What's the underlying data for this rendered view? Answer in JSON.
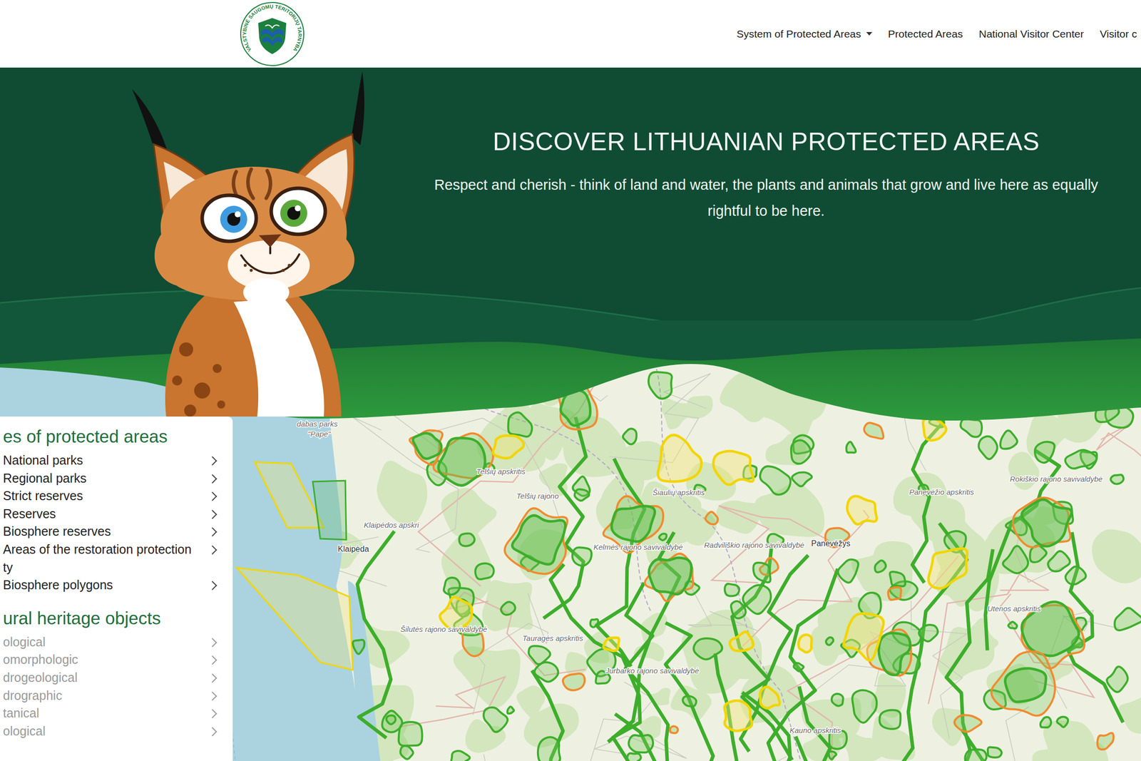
{
  "header": {
    "logo_text": "VALSTYBINĖ SAUGOMŲ TERITORIJŲ TARNYBA",
    "nav": [
      {
        "label": "System of Protected Areas",
        "dropdown": true
      },
      {
        "label": "Protected Areas",
        "dropdown": false
      },
      {
        "label": "National Visitor Center",
        "dropdown": false
      },
      {
        "label": "Visitor c",
        "dropdown": false
      }
    ]
  },
  "hero": {
    "title": "DISCOVER LITHUANIAN PROTECTED AREAS",
    "subtitle": "Respect and cherish - think of land and water, the plants and animals that grow and live here as equally rightful to be here."
  },
  "sidebar": {
    "sections": [
      {
        "title": "es of protected areas",
        "items": [
          {
            "lines": [
              "National parks"
            ],
            "muted": false
          },
          {
            "lines": [
              "Regional parks"
            ],
            "muted": false
          },
          {
            "lines": [
              "Strict reserves"
            ],
            "muted": false
          },
          {
            "lines": [
              "Reserves"
            ],
            "muted": false
          },
          {
            "lines": [
              "Biosphere reserves"
            ],
            "muted": false
          },
          {
            "lines": [
              "Areas of the restoration protection",
              "ty"
            ],
            "muted": false
          },
          {
            "lines": [
              "Biosphere polygons"
            ],
            "muted": false
          }
        ]
      },
      {
        "title": "ural heritage objects",
        "items": [
          {
            "lines": [
              "ological"
            ],
            "muted": true
          },
          {
            "lines": [
              "omorphologic"
            ],
            "muted": true
          },
          {
            "lines": [
              "drogeological"
            ],
            "muted": true
          },
          {
            "lines": [
              "drographic"
            ],
            "muted": true
          },
          {
            "lines": [
              "tanical"
            ],
            "muted": true
          },
          {
            "lines": [
              "ological"
            ],
            "muted": true
          }
        ]
      }
    ]
  },
  "map": {
    "labels": [
      "dabas parks",
      "\"Pape\"",
      "Telšių apskritis",
      "Telšių rajono",
      "Šiaulių apskritis",
      "Panevėžio apskritis",
      "Rokiškio rajono savivaldybė",
      "Klaipėdos apskri",
      "Klaipėda",
      "Kelmės rajono savivaldybė",
      "Radviliškio rajono savivaldybė",
      "Panevėžys",
      "Utenos apskritis",
      "Šilutės rajono savivaldybė",
      "Tauragės apskritis",
      "Jurbarko rajono savivaldybė",
      "Kauno apskritis"
    ]
  }
}
